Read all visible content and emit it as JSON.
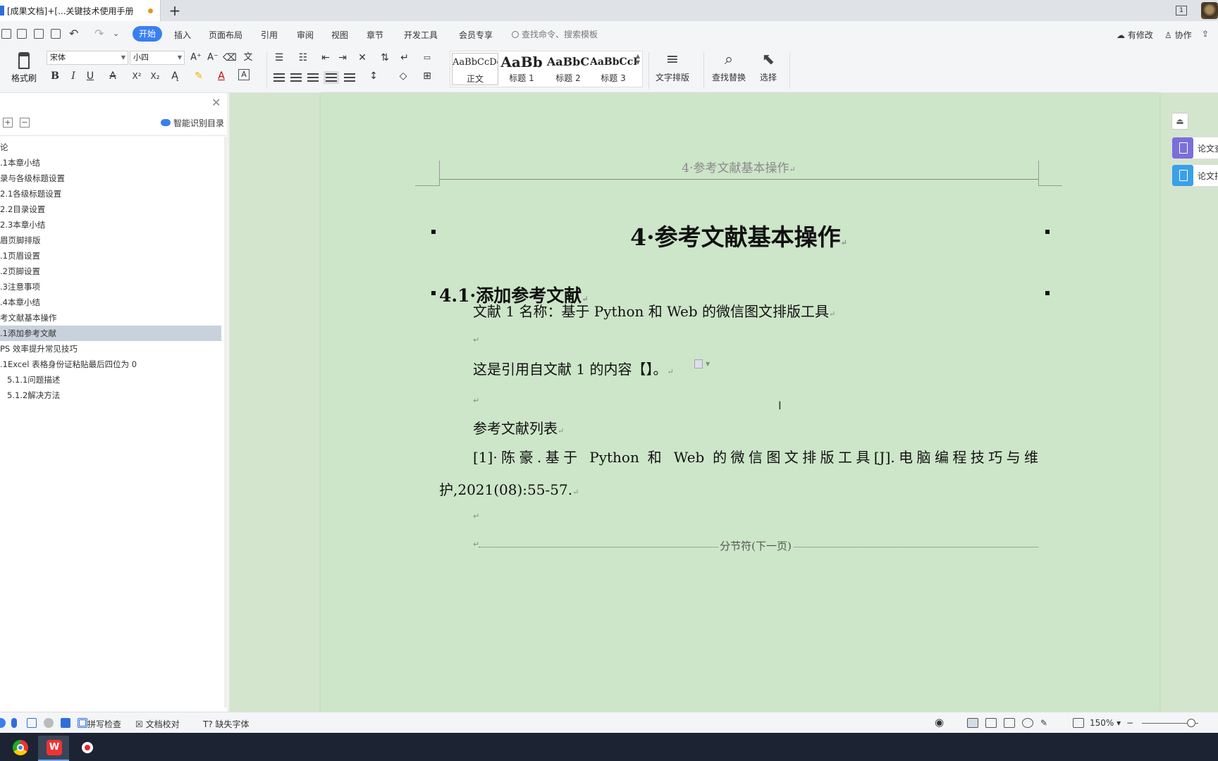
{
  "titlebar": {
    "doc_tab_title": "[成果文档]+[...关键技术使用手册",
    "new_tab": "+",
    "page_indicator": "1"
  },
  "menubar": {
    "items": [
      "开始",
      "插入",
      "页面布局",
      "引用",
      "审阅",
      "视图",
      "章节",
      "开发工具",
      "会员专享"
    ],
    "search_placeholder": "查找命令、搜索模板",
    "right": {
      "changes": "有修改",
      "collab": "协作",
      "share": "分享"
    }
  },
  "ribbon": {
    "format_painter": "格式刷",
    "font_name": "宋体",
    "font_size": "小四",
    "font_buttons": {
      "bold": "B",
      "italic": "I",
      "underline": "U",
      "superscript": "X²",
      "subscript": "X₂",
      "font_color": "A",
      "char_border": "A"
    },
    "styles": [
      {
        "sample": "AaBbCcDd",
        "name": "正文"
      },
      {
        "sample": "AaBb",
        "name": "标题 1"
      },
      {
        "sample": "AaBbC",
        "name": "标题 2"
      },
      {
        "sample": "AaBbCcI",
        "name": "标题 3"
      }
    ],
    "text_layout": "文字排版",
    "find_replace": "查找替换",
    "select": "选择"
  },
  "nav": {
    "smart_toc": "智能识别目录",
    "items": [
      {
        "text": "论",
        "selected": false
      },
      {
        "text": ".1本章小结",
        "selected": false
      },
      {
        "text": "录与各级标题设置",
        "selected": false
      },
      {
        "text": "2.1各级标题设置",
        "selected": false
      },
      {
        "text": "2.2目录设置",
        "selected": false
      },
      {
        "text": "2.3本章小结",
        "selected": false
      },
      {
        "text": "眉页脚排版",
        "selected": false
      },
      {
        "text": ".1页眉设置",
        "selected": false
      },
      {
        "text": ".2页脚设置",
        "selected": false
      },
      {
        "text": ".3注意事项",
        "selected": false
      },
      {
        "text": ".4本章小结",
        "selected": false
      },
      {
        "text": "考文献基本操作",
        "selected": false
      },
      {
        "text": ".1添加参考文献",
        "selected": true
      },
      {
        "text": "PS 效率提升常见技巧",
        "selected": false
      },
      {
        "text": ".1Excel 表格身份证粘贴最后四位为 0",
        "selected": false
      },
      {
        "text": "5.1.1问题描述",
        "selected": false,
        "indent": true
      },
      {
        "text": "5.1.2解决方法",
        "selected": false,
        "indent": true
      }
    ]
  },
  "document": {
    "header": "4·参考文献基本操作",
    "heading1": "4·参考文献基本操作",
    "heading2": "4.1·添加参考文献",
    "para1": "文献 1 名称：基于 Python 和 Web 的微信图文排版工具",
    "para2": "这是引用自文献 1 的内容【】。",
    "para3": "参考文献列表",
    "ref1": "[1]·陈豪.基于 Python 和 Web 的微信图文排版工具[J].电脑编程技巧与维护,2021(08):55-57.",
    "para_mark": "↵",
    "section_break": "分节符(下一页)"
  },
  "right_panel": {
    "tab1": "论文查",
    "tab2": "论文排",
    "tab1_color": "#7b6fd8",
    "tab2_color": "#3aa0e8"
  },
  "statusbar": {
    "spell_check": "拼写检查",
    "doc_proof": "文档校对",
    "missing_fonts": "缺失字体",
    "zoom": "150%"
  },
  "colors": {
    "accent": "#3a7ff0",
    "doc_background": "#cde6c9"
  }
}
